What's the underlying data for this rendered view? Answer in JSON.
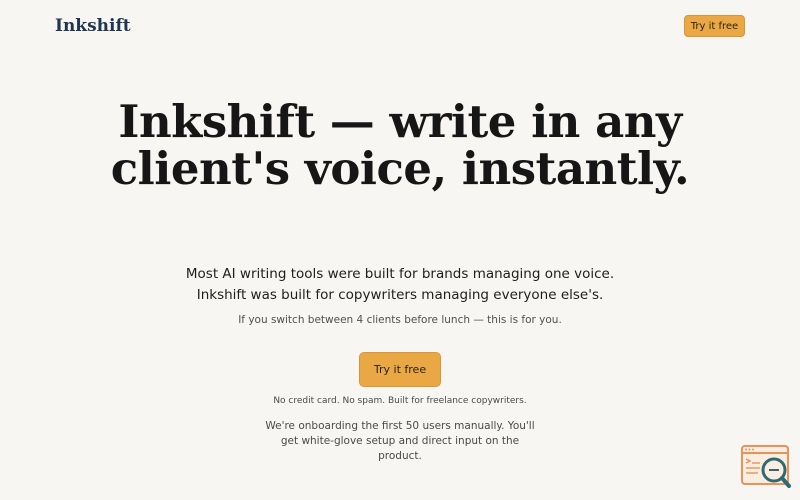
{
  "header": {
    "logo": "Inkshift",
    "cta_label": "Try it free"
  },
  "hero": {
    "title": "Inkshift — write in any client's voice, instantly.",
    "subhead_line1": "Most AI writing tools were built for brands managing one voice.",
    "subhead_line2": "Inkshift was built for copywriters managing everyone else's.",
    "tagline": "If you switch between 4 clients before lunch — this is for you.",
    "cta_label": "Try it free",
    "fineprint": "No credit card. No spam. Built for freelance copywriters.",
    "onboarding_note": "We're onboarding the first 50 users manually. You'll get white-glove setup and direct input on the product."
  },
  "widget": {
    "icon": "browser-search-icon"
  },
  "colors": {
    "background": "#f8f6f2",
    "accent": "#eaa844",
    "logo": "#1f3550",
    "widget_teal": "#2e6a74"
  }
}
